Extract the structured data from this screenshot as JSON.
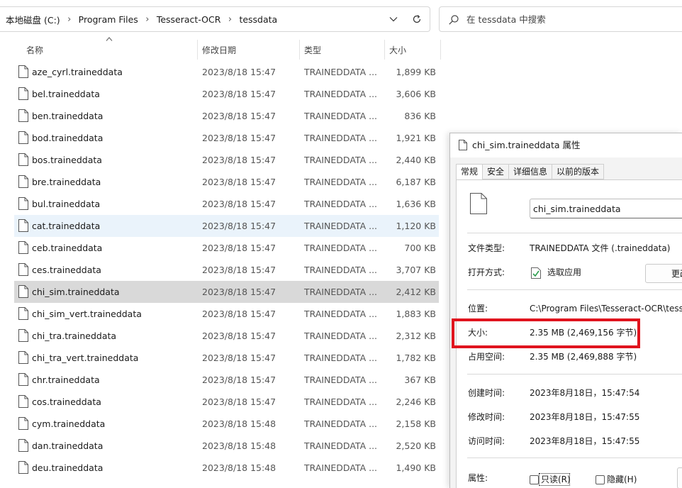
{
  "address": {
    "crumbs": [
      "本地磁盘 (C:)",
      "Program Files",
      "Tesseract-OCR",
      "tessdata"
    ],
    "separator": "›"
  },
  "search": {
    "placeholder": "在 tessdata 中搜索"
  },
  "columns": {
    "name": "名称",
    "modified": "修改日期",
    "type": "类型",
    "size": "大小"
  },
  "files": [
    {
      "name": "aze_cyrl.traineddata",
      "date": "2023/8/18 15:47",
      "type": "TRAINEDDATA ...",
      "size": "1,899 KB"
    },
    {
      "name": "bel.traineddata",
      "date": "2023/8/18 15:47",
      "type": "TRAINEDDATA ...",
      "size": "3,606 KB"
    },
    {
      "name": "ben.traineddata",
      "date": "2023/8/18 15:47",
      "type": "TRAINEDDATA ...",
      "size": "836 KB"
    },
    {
      "name": "bod.traineddata",
      "date": "2023/8/18 15:47",
      "type": "TRAINEDDATA ...",
      "size": "1,921 KB"
    },
    {
      "name": "bos.traineddata",
      "date": "2023/8/18 15:47",
      "type": "TRAINEDDATA ...",
      "size": "2,440 KB"
    },
    {
      "name": "bre.traineddata",
      "date": "2023/8/18 15:47",
      "type": "TRAINEDDATA ...",
      "size": "6,187 KB"
    },
    {
      "name": "bul.traineddata",
      "date": "2023/8/18 15:47",
      "type": "TRAINEDDATA ...",
      "size": "1,636 KB"
    },
    {
      "name": "cat.traineddata",
      "date": "2023/8/18 15:47",
      "type": "TRAINEDDATA ...",
      "size": "1,120 KB"
    },
    {
      "name": "ceb.traineddata",
      "date": "2023/8/18 15:47",
      "type": "TRAINEDDATA ...",
      "size": "700 KB"
    },
    {
      "name": "ces.traineddata",
      "date": "2023/8/18 15:47",
      "type": "TRAINEDDATA ...",
      "size": "3,707 KB"
    },
    {
      "name": "chi_sim.traineddata",
      "date": "2023/8/18 15:47",
      "type": "TRAINEDDATA ...",
      "size": "2,412 KB"
    },
    {
      "name": "chi_sim_vert.traineddata",
      "date": "2023/8/18 15:47",
      "type": "TRAINEDDATA ...",
      "size": "1,883 KB"
    },
    {
      "name": "chi_tra.traineddata",
      "date": "2023/8/18 15:47",
      "type": "TRAINEDDATA ...",
      "size": "2,312 KB"
    },
    {
      "name": "chi_tra_vert.traineddata",
      "date": "2023/8/18 15:47",
      "type": "TRAINEDDATA ...",
      "size": "1,782 KB"
    },
    {
      "name": "chr.traineddata",
      "date": "2023/8/18 15:47",
      "type": "TRAINEDDATA ...",
      "size": "367 KB"
    },
    {
      "name": "cos.traineddata",
      "date": "2023/8/18 15:47",
      "type": "TRAINEDDATA ...",
      "size": "2,246 KB"
    },
    {
      "name": "cym.traineddata",
      "date": "2023/8/18 15:48",
      "type": "TRAINEDDATA ...",
      "size": "2,158 KB"
    },
    {
      "name": "dan.traineddata",
      "date": "2023/8/18 15:48",
      "type": "TRAINEDDATA ...",
      "size": "2,520 KB"
    },
    {
      "name": "deu.traineddata",
      "date": "2023/8/18 15:48",
      "type": "TRAINEDDATA ...",
      "size": "1,490 KB"
    }
  ],
  "hovered_file": "cat.traineddata",
  "selected_file": "chi_sim.traineddata",
  "dialog": {
    "title": "chi_sim.traineddata 属性",
    "tabs": [
      "常规",
      "安全",
      "详细信息",
      "以前的版本"
    ],
    "active_tab": "常规",
    "file_name": "chi_sim.traineddata",
    "file_type_label": "文件类型:",
    "file_type_value": "TRAINEDDATA 文件 (.traineddata)",
    "opens_with_label": "打开方式:",
    "opens_with_value": "选取应用",
    "change_button": "更改",
    "location_label": "位置:",
    "location_value": "C:\\Program Files\\Tesseract-OCR\\tessdata",
    "size_label": "大小:",
    "size_value": "2.35 MB (2,469,156 字节)",
    "size_on_disk_label": "占用空间:",
    "size_on_disk_value": "2.35 MB (2,469,888 字节)",
    "created_label": "创建时间:",
    "created_value": "2023年8月18日，15:47:54",
    "modified_label": "修改时间:",
    "modified_value": "2023年8月18日，15:47:55",
    "accessed_label": "访问时间:",
    "accessed_value": "2023年8月18日，15:47:55",
    "attributes_label": "属性:",
    "readonly_label": "只读(R)",
    "hidden_label": "隐藏(H)"
  },
  "colors": {
    "highlight": "#e0141e",
    "hover_row": "#eaf3fb",
    "selected_row": "#d9d9d9"
  },
  "icons": [
    "chevron-right-icon",
    "chevron-down-icon",
    "refresh-icon",
    "search-icon",
    "file-icon",
    "app-icon",
    "sort-up-icon"
  ]
}
